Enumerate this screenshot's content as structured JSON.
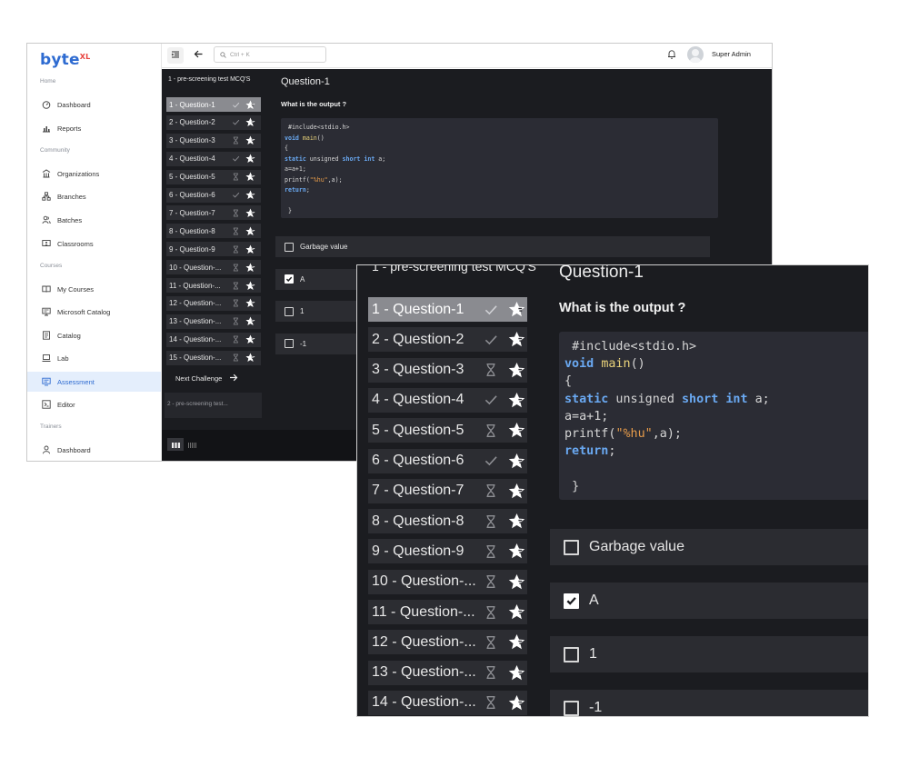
{
  "brand": {
    "name": "byte",
    "superscript": "XL"
  },
  "sidebar": {
    "sections": [
      {
        "label": "Home",
        "items": [
          {
            "label": "Dashboard",
            "icon": "gauge-icon"
          },
          {
            "label": "Reports",
            "icon": "bar-chart-icon"
          }
        ]
      },
      {
        "label": "Community",
        "items": [
          {
            "label": "Organizations",
            "icon": "building-icon"
          },
          {
            "label": "Branches",
            "icon": "branches-icon"
          },
          {
            "label": "Batches",
            "icon": "users-icon"
          },
          {
            "label": "Classrooms",
            "icon": "classroom-icon"
          }
        ]
      },
      {
        "label": "Courses",
        "items": [
          {
            "label": "My Courses",
            "icon": "book-icon"
          },
          {
            "label": "Microsoft Catalog",
            "icon": "monitor-icon"
          },
          {
            "label": "Catalog",
            "icon": "catalog-icon"
          },
          {
            "label": "Lab",
            "icon": "laptop-icon"
          },
          {
            "label": "Assessment",
            "icon": "assessment-icon",
            "active": true
          },
          {
            "label": "Editor",
            "icon": "editor-icon"
          }
        ]
      },
      {
        "label": "Trainers",
        "items": [
          {
            "label": "Dashboard",
            "icon": "user-icon"
          }
        ]
      }
    ]
  },
  "topbar": {
    "search_placeholder": "Ctrl + K",
    "user_name": "Super Admin"
  },
  "question_panel": {
    "title": "1 - pre-screening test MCQ'S",
    "questions": [
      {
        "label": "1 - Question-1",
        "status": "answered",
        "selected": true
      },
      {
        "label": "2 - Question-2",
        "status": "answered"
      },
      {
        "label": "3 - Question-3",
        "status": "pending"
      },
      {
        "label": "4 - Question-4",
        "status": "answered"
      },
      {
        "label": "5 - Question-5",
        "status": "pending"
      },
      {
        "label": "6 - Question-6",
        "status": "answered"
      },
      {
        "label": "7 - Question-7",
        "status": "pending"
      },
      {
        "label": "8 - Question-8",
        "status": "pending"
      },
      {
        "label": "9 - Question-9",
        "status": "pending"
      },
      {
        "label": "10 - Question-...",
        "status": "pending"
      },
      {
        "label": "11 - Question-...",
        "status": "pending"
      },
      {
        "label": "12 - Question-...",
        "status": "pending"
      },
      {
        "label": "13 - Question-...",
        "status": "pending"
      },
      {
        "label": "14 - Question-...",
        "status": "pending"
      },
      {
        "label": "15 - Question-...",
        "status": "pending"
      }
    ],
    "next_label": "Next Challenge",
    "next_section": "2 - pre-screening test..."
  },
  "question": {
    "title": "Question-1",
    "text": "What is the output ?",
    "code": [
      {
        "indent": " ",
        "parts": [
          {
            "t": "#include<stdio.h>",
            "c": ""
          }
        ]
      },
      {
        "parts": [
          {
            "t": "void",
            "c": "kw"
          },
          {
            "t": " ",
            "c": ""
          },
          {
            "t": "main",
            "c": "fn"
          },
          {
            "t": "()",
            "c": ""
          }
        ]
      },
      {
        "parts": [
          {
            "t": "{",
            "c": ""
          }
        ]
      },
      {
        "parts": [
          {
            "t": "static",
            "c": "kw"
          },
          {
            "t": " unsigned ",
            "c": ""
          },
          {
            "t": "short",
            "c": "kw"
          },
          {
            "t": " ",
            "c": ""
          },
          {
            "t": "int",
            "c": "kw"
          },
          {
            "t": " a;",
            "c": ""
          }
        ]
      },
      {
        "parts": [
          {
            "t": "a=a+1;",
            "c": ""
          }
        ]
      },
      {
        "parts": [
          {
            "t": "printf(",
            "c": ""
          },
          {
            "t": "\"%hu\"",
            "c": "strv"
          },
          {
            "t": ",a);",
            "c": ""
          }
        ]
      },
      {
        "parts": [
          {
            "t": "return",
            "c": "kw"
          },
          {
            "t": ";",
            "c": ""
          }
        ]
      },
      {
        "parts": [
          {
            "t": "",
            "c": ""
          }
        ]
      },
      {
        "indent": " ",
        "parts": [
          {
            "t": "}",
            "c": ""
          }
        ]
      }
    ],
    "options": [
      {
        "label": "Garbage value",
        "checked": false
      },
      {
        "label": "A",
        "checked": true
      },
      {
        "label": "1",
        "checked": false
      },
      {
        "label": "-1",
        "checked": false
      }
    ]
  },
  "colors": {
    "accent": "#2e6bd1",
    "dark_bg": "#1b1c20",
    "selected_item": "#8a8b90",
    "keyword": "#6aa9f2"
  }
}
